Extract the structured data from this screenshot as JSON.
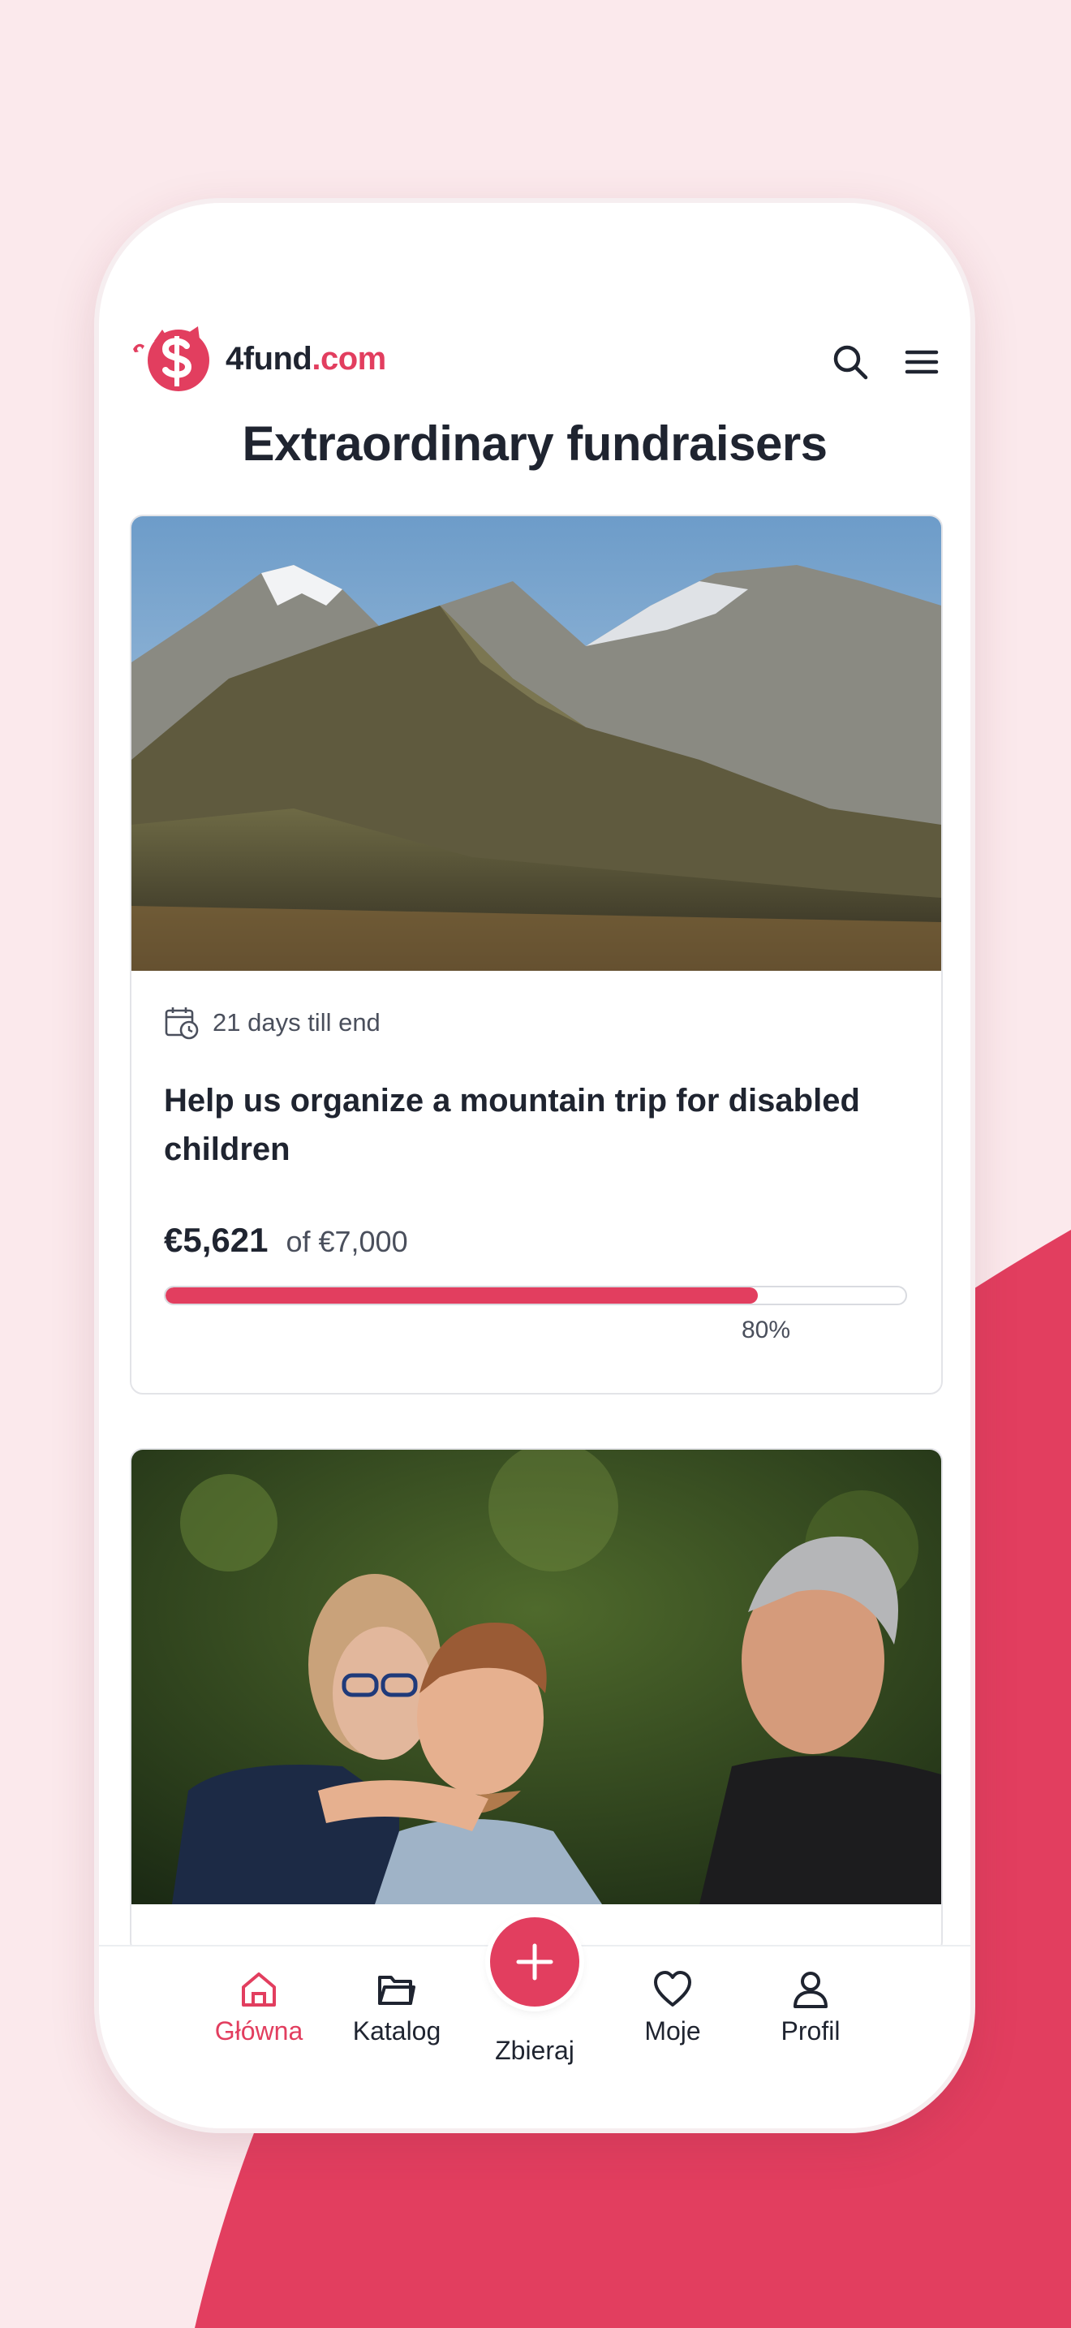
{
  "app": {
    "logo_text_main": "4fund",
    "logo_text_suffix": ".com",
    "brand_color": "#e23e5f",
    "icons": [
      "piggy-bank-logo-icon",
      "search-icon",
      "menu-icon"
    ]
  },
  "page": {
    "title": "Extraordinary fundraisers"
  },
  "fundraisers": [
    {
      "image": "mountain-landscape-photo",
      "days_left": "21 days till end",
      "title": "Help us organize a mountain trip for disabled children",
      "raised": "€5,621",
      "goal": "of €7,000",
      "progress": 0.8,
      "percent_label": "80%"
    },
    {
      "image": "family-hug-photo"
    }
  ],
  "tabbar": {
    "items": [
      {
        "label": "Główna",
        "icon": "home-icon",
        "active": true
      },
      {
        "label": "Katalog",
        "icon": "folder-icon",
        "active": false
      },
      {
        "label": "Zbieraj",
        "icon": "plus-icon",
        "active": false
      },
      {
        "label": "Moje",
        "icon": "heart-icon",
        "active": false
      },
      {
        "label": "Profil",
        "icon": "user-icon",
        "active": false
      }
    ]
  }
}
